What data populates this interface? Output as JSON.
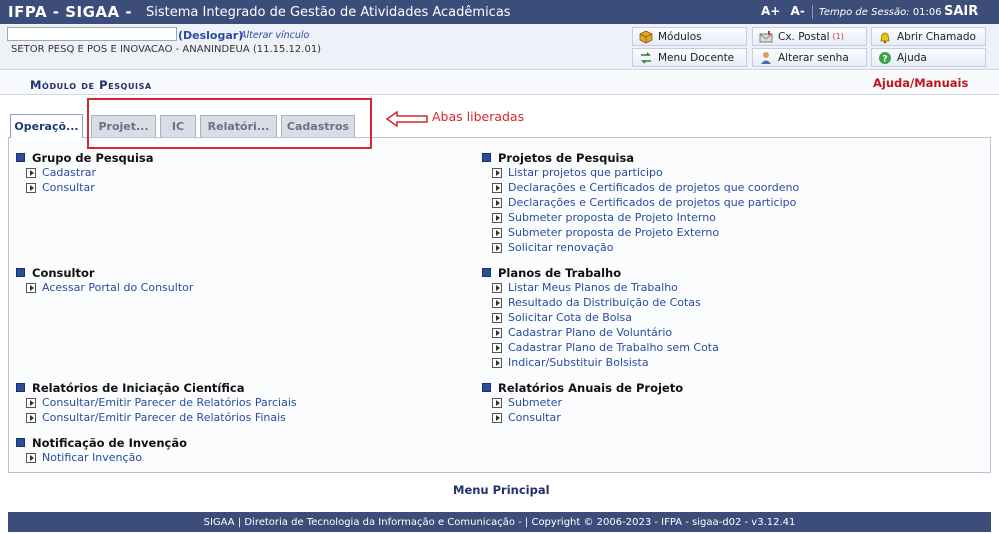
{
  "topbar": {
    "brand": "IFPA - SIGAA -",
    "system_name": "Sistema Integrado de Gestão de Atividades Acadêmicas",
    "font_increase": "A+",
    "font_decrease": "A-",
    "session_label": "Tempo de Sessão:",
    "session_time": "01:06",
    "logout": "SAIR"
  },
  "user": {
    "deslogar": "(Deslogar)",
    "alterar_vinculo": "Alterar vínculo",
    "setor": "SETOR PESQ E POS E INOVACAO - ANANINDEUA (11.15.12.01)"
  },
  "quick": {
    "modulos": "Módulos",
    "caixa_postal": "Cx. Postal",
    "caixa_postal_count": "(1)",
    "abrir_chamado": "Abrir Chamado",
    "menu_docente": "Menu Docente",
    "alterar_senha": "Alterar senha",
    "ajuda": "Ajuda"
  },
  "module": {
    "title": "Módulo de Pesquisa",
    "help_manuals": "Ajuda/Manuais"
  },
  "tabs": [
    {
      "label": "Operaçõ..."
    },
    {
      "label": "Projet..."
    },
    {
      "label": "IC"
    },
    {
      "label": "Relatóri..."
    },
    {
      "label": "Cadastros"
    }
  ],
  "annotation": {
    "text": "Abas liberadas"
  },
  "sections": {
    "grupo": {
      "title": "Grupo de Pesquisa",
      "links": [
        "Cadastrar",
        "Consultar"
      ]
    },
    "consultor": {
      "title": "Consultor",
      "links": [
        "Acessar Portal do Consultor"
      ]
    },
    "relatorios_ic": {
      "title": "Relatórios de Iniciação Científica",
      "links": [
        "Consultar/Emitir Parecer de Relatórios Parciais",
        "Consultar/Emitir Parecer de Relatórios Finais"
      ]
    },
    "notificacao": {
      "title": "Notificação de Invenção",
      "links": [
        "Notificar Invenção"
      ]
    },
    "projetos": {
      "title": "Projetos de Pesquisa",
      "links": [
        "Listar projetos que participo",
        "Declarações e Certificados de projetos que coordeno",
        "Declarações e Certificados de projetos que participo",
        "Submeter proposta de Projeto Interno",
        "Submeter proposta de Projeto Externo",
        "Solicitar renovação"
      ]
    },
    "planos": {
      "title": "Planos de Trabalho",
      "links": [
        "Listar Meus Planos de Trabalho",
        "Resultado da Distribuição de Cotas",
        "Solicitar Cota de Bolsa",
        "Cadastrar Plano de Voluntário",
        "Cadastrar Plano de Trabalho sem Cota",
        "Indicar/Substituir Bolsista"
      ]
    },
    "relatorios_anuais": {
      "title": "Relatórios Anuais de Projeto",
      "links": [
        "Submeter",
        "Consultar"
      ]
    }
  },
  "menu_principal": "Menu Principal",
  "footer": "SIGAA | Diretoria de Tecnologia da Informação e Comunicação - | Copyright © 2006-2023 - IFPA - sigaa-d02 - v3.12.41",
  "colors": {
    "header_bg": "#3d4d7a",
    "link": "#2a4c9e",
    "annotation": "#d6282e"
  }
}
